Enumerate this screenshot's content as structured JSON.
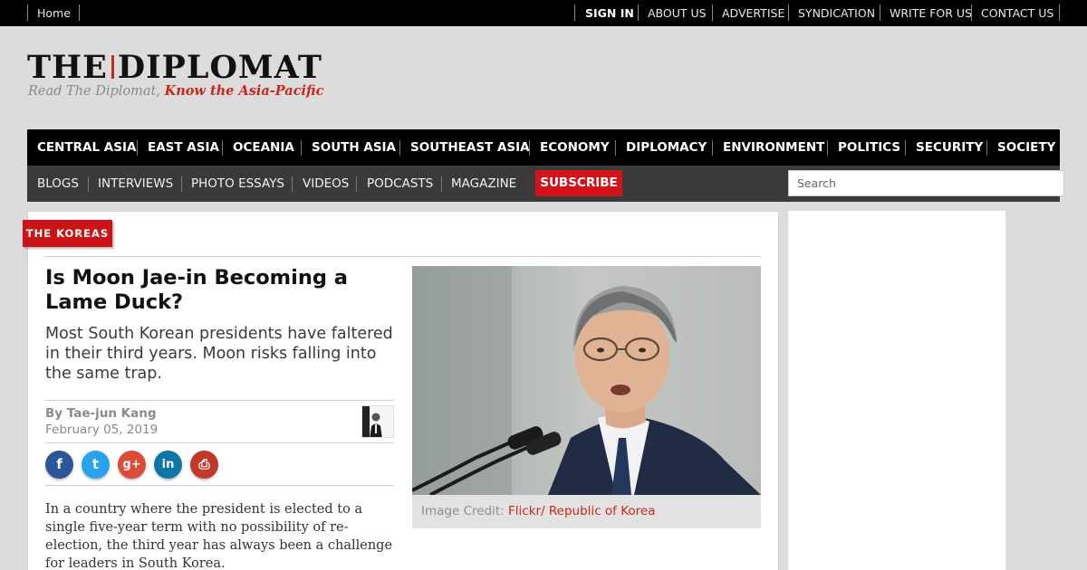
{
  "topbar": {
    "home": "Home",
    "sign_in": "SIGN IN",
    "about_us": "ABOUT US",
    "advertise": "ADVERTISE",
    "syndication": "SYNDICATION",
    "write_for_us": "WRITE FOR US",
    "contact_us": "CONTACT US"
  },
  "brand": {
    "logo_left": "THE",
    "logo_right": "DIPLOMAT",
    "tagline_plain": "Read The Diplomat, ",
    "tagline_accent": "Know the Asia-Pacific",
    "accent_color": "#c8281b"
  },
  "main_nav": {
    "items": [
      "CENTRAL ASIA",
      "EAST ASIA",
      "OCEANIA",
      "SOUTH ASIA",
      "SOUTHEAST ASIA",
      "ECONOMY",
      "DIPLOMACY",
      "ENVIRONMENT",
      "POLITICS",
      "SECURITY",
      "SOCIETY"
    ]
  },
  "sub_nav": {
    "items": [
      "BLOGS",
      "INTERVIEWS",
      "PHOTO ESSAYS",
      "VIDEOS",
      "PODCASTS",
      "MAGAZINE"
    ],
    "subscribe": "SUBSCRIBE",
    "search_placeholder": "Search"
  },
  "article": {
    "category": "THE KOREAS",
    "headline": "Is Moon Jae-in Becoming a Lame Duck?",
    "dek": "Most South Korean presidents have faltered in their third years. Moon risks falling into the same trap.",
    "by": "By ",
    "author": "Tae-jun Kang",
    "date": "February 05, 2019",
    "share_icons": [
      "facebook-icon",
      "twitter-icon",
      "google-plus-icon",
      "linkedin-icon",
      "print-icon"
    ],
    "share_glyphs": [
      "f",
      "t",
      "g+",
      "in",
      "⎙"
    ],
    "body": "In a country where the president is elected to a single five-year term with no possibility of re-election, the third year has always been a challenge for leaders in South Korea.",
    "image_credit_label": "Image Credit: ",
    "image_credit": "Flickr/ Republic of Korea"
  }
}
